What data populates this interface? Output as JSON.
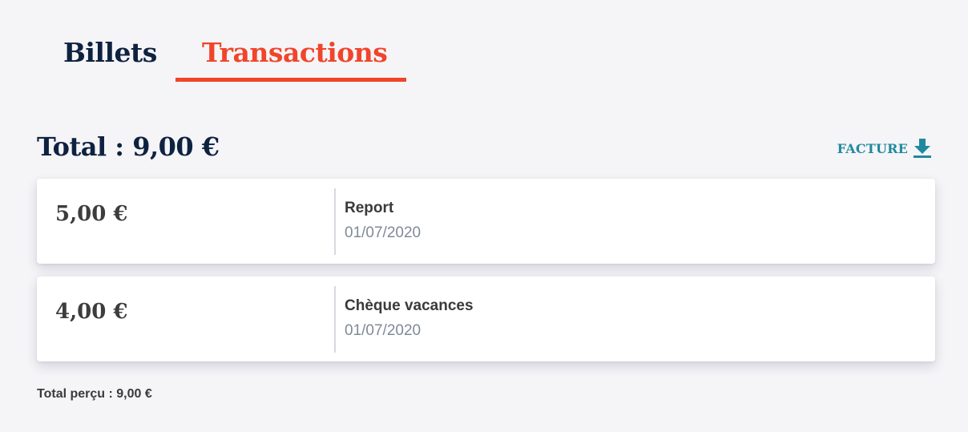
{
  "tabs": [
    {
      "label": "Billets",
      "active": false
    },
    {
      "label": "Transactions",
      "active": true
    }
  ],
  "summary": {
    "total_label": "Total : 9,00 €"
  },
  "actions": {
    "facture_label": "FACTURE",
    "facture_icon": "download-icon"
  },
  "transactions": [
    {
      "amount": "5,00 €",
      "title": "Report",
      "date": "01/07/2020"
    },
    {
      "amount": "4,00 €",
      "title": "Chèque vacances",
      "date": "01/07/2020"
    }
  ],
  "footer": {
    "total_percu": "Total perçu : 9,00 €"
  },
  "colors": {
    "background": "#f5f4f7",
    "active_tab": "#f0452b",
    "heading": "#0e2240",
    "link": "#1f8a9e",
    "muted_text": "#7f8a97"
  }
}
